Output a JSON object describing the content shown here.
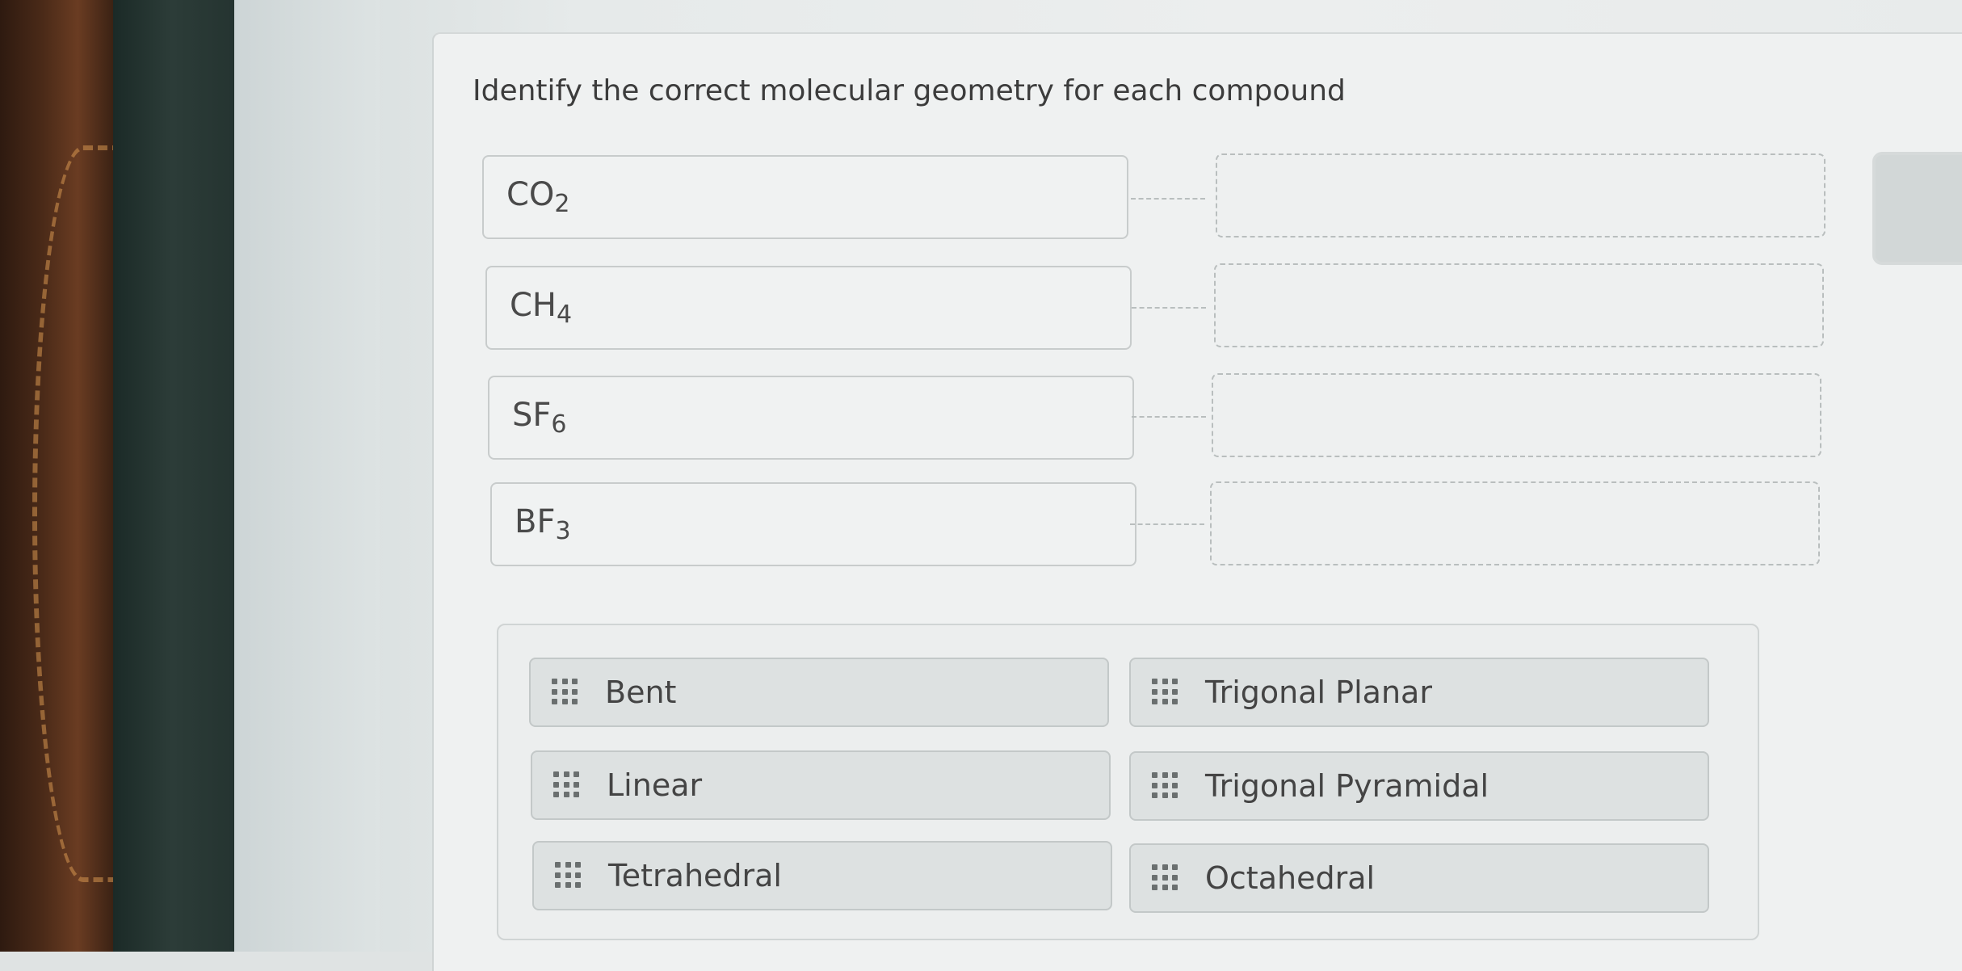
{
  "instruction": "Identify the correct molecular geometry for each compound",
  "compounds": [
    {
      "base": "CO",
      "sub": "2"
    },
    {
      "base": "CH",
      "sub": "4"
    },
    {
      "base": "SF",
      "sub": "6"
    },
    {
      "base": "BF",
      "sub": "3"
    }
  ],
  "options": [
    {
      "label": "Bent",
      "icon": "drag-handle-icon"
    },
    {
      "label": "Trigonal Planar",
      "icon": "drag-handle-icon"
    },
    {
      "label": "Linear",
      "icon": "drag-handle-icon"
    },
    {
      "label": "Trigonal Pyramidal",
      "icon": "drag-handle-icon"
    },
    {
      "label": "Tetrahedral",
      "icon": "drag-handle-icon"
    },
    {
      "label": "Octahedral",
      "icon": "drag-handle-icon"
    }
  ]
}
